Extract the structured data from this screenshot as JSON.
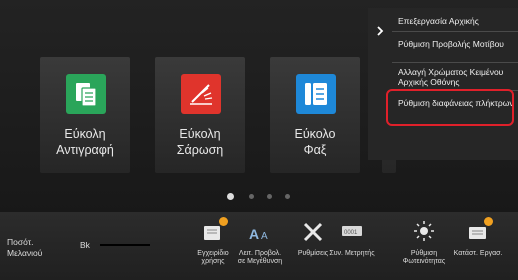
{
  "tiles": [
    {
      "label_line1": "Εύκολη",
      "label_line2": "Αντιγραφή",
      "icon": "copy-icon",
      "color": "#2aa55a"
    },
    {
      "label_line1": "Εύκολη",
      "label_line2": "Σάρωση",
      "icon": "scan-icon",
      "color": "#e0342c"
    },
    {
      "label_line1": "Εύκολο",
      "label_line2": "Φαξ",
      "icon": "fax-icon",
      "color": "#1e88d8"
    }
  ],
  "action_panel": {
    "expand_icon": "chevron-right-icon",
    "items": [
      "Επεξεργασία Αρχικής",
      "Ρύθμιση Προβολής Μοτίβου",
      "Αλλαγή Χρώματος Κειμένου Αρχικής Οθόνης",
      "Ρύθμιση διαφάνειας πλήκτρων"
    ],
    "highlight_color": "#e0202a"
  },
  "page_indicator": {
    "total": 4,
    "active": 1
  },
  "toner": {
    "label_line1": "Ποσότ.",
    "label_line2": "Μελανιού",
    "channel": "Bk"
  },
  "toolbar": [
    {
      "line1": "Εγχειρίδιο",
      "line2": "χρήσης",
      "icon": "manual-icon"
    },
    {
      "line1": "Λειτ. Προβολ.",
      "line2": "σε Μεγέθυνση",
      "icon": "text-size-icon"
    },
    {
      "line1": "Ρυθμίσεις",
      "line2": "",
      "icon": "tools-icon"
    },
    {
      "line1": "Συν. Μετρητής",
      "line2": "",
      "icon": "counter-icon"
    },
    {
      "line1": "Ρύθμιση",
      "line2": "Φωτεινότητας",
      "icon": "brightness-icon"
    },
    {
      "line1": "Κατάστ. Εργασ.",
      "line2": "",
      "icon": "job-status-icon"
    }
  ]
}
